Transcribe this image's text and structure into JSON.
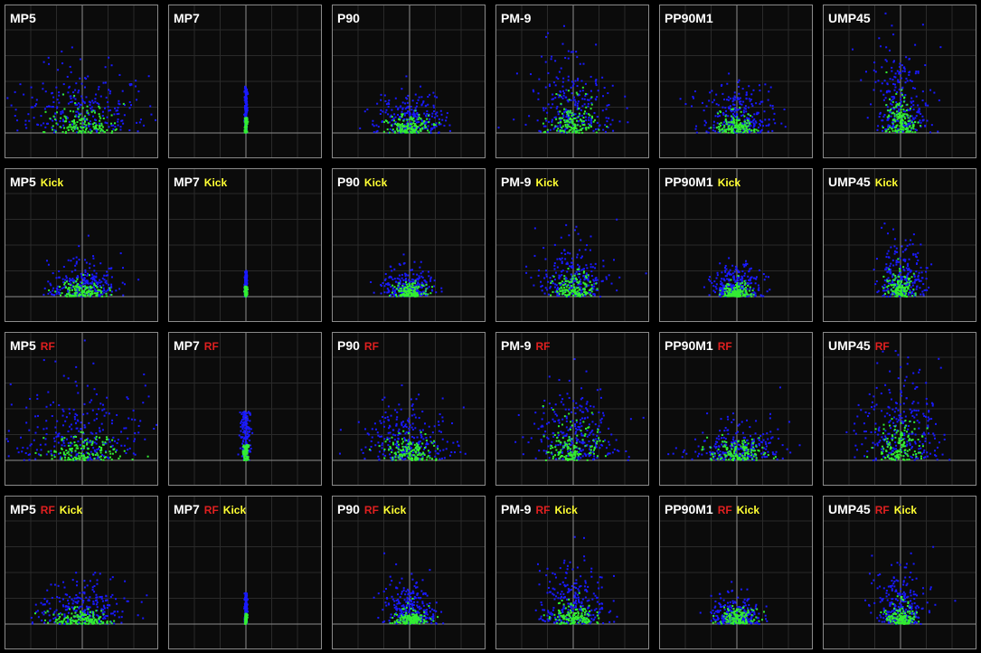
{
  "colors": {
    "background": "#000000",
    "panel_bg": "#0b0b0b",
    "panel_border": "#8a8a8a",
    "grid": "#2a2a2a",
    "axis": "#8c8c8c",
    "blue": "#1a1aff",
    "green": "#33ee33",
    "rf_tag": "#e02020",
    "kick_tag": "#ffff33"
  },
  "chart_data": {
    "type": "scatter",
    "grid": true,
    "weapons": [
      "MP5",
      "MP7",
      "P90",
      "PM-9",
      "PP90M1",
      "UMP45"
    ],
    "rows": [
      {
        "tags": []
      },
      {
        "tags": [
          "Kick"
        ]
      },
      {
        "tags": [
          "RF"
        ]
      },
      {
        "tags": [
          "RF",
          "Kick"
        ]
      }
    ],
    "series": [
      {
        "color": "blue"
      },
      {
        "color": "green"
      }
    ],
    "spread": [
      [
        {
          "bw": 2.3,
          "bh": 2.3,
          "gw": 1.3,
          "gh": 0.8
        },
        {
          "bw": 0.05,
          "bh": 1.8,
          "gw": 0.05,
          "gh": 0.6,
          "vertical": true
        },
        {
          "bw": 1.2,
          "bh": 1.4,
          "gw": 0.8,
          "gh": 0.6
        },
        {
          "bw": 1.4,
          "bh": 2.4,
          "gw": 0.8,
          "gh": 1.1
        },
        {
          "bw": 1.2,
          "bh": 1.6,
          "gw": 0.7,
          "gh": 0.7
        },
        {
          "bw": 1.0,
          "bh": 2.8,
          "gw": 0.5,
          "gh": 1.2
        }
      ],
      [
        {
          "bw": 1.2,
          "bh": 1.2,
          "gw": 0.8,
          "gh": 0.5
        },
        {
          "bw": 0.05,
          "bh": 1.0,
          "gw": 0.05,
          "gh": 0.4,
          "vertical": true
        },
        {
          "bw": 1.0,
          "bh": 0.9,
          "gw": 0.5,
          "gh": 0.4
        },
        {
          "bw": 1.2,
          "bh": 1.8,
          "gw": 0.7,
          "gh": 0.8
        },
        {
          "bw": 0.9,
          "bh": 1.0,
          "gw": 0.5,
          "gh": 0.5
        },
        {
          "bw": 0.9,
          "bh": 1.7,
          "gw": 0.5,
          "gh": 0.8
        }
      ],
      [
        {
          "bw": 2.4,
          "bh": 2.5,
          "gw": 1.3,
          "gh": 0.8
        },
        {
          "bw": 0.2,
          "bh": 1.9,
          "gw": 0.12,
          "gh": 0.6,
          "vertical": true
        },
        {
          "bw": 1.6,
          "bh": 1.8,
          "gw": 0.9,
          "gh": 0.8
        },
        {
          "bw": 1.5,
          "bh": 2.5,
          "gw": 0.9,
          "gh": 1.2
        },
        {
          "bw": 1.6,
          "bh": 1.2,
          "gw": 1.0,
          "gh": 0.7
        },
        {
          "bw": 1.4,
          "bh": 3.0,
          "gw": 0.8,
          "gh": 1.3
        }
      ],
      [
        {
          "bw": 1.5,
          "bh": 1.5,
          "gw": 1.0,
          "gh": 0.5
        },
        {
          "bw": 0.05,
          "bh": 1.2,
          "gw": 0.05,
          "gh": 0.4,
          "vertical": true
        },
        {
          "bw": 0.9,
          "bh": 1.4,
          "gw": 0.6,
          "gh": 0.5
        },
        {
          "bw": 1.2,
          "bh": 2.0,
          "gw": 0.7,
          "gh": 0.7
        },
        {
          "bw": 0.9,
          "bh": 0.9,
          "gw": 0.6,
          "gh": 0.5
        },
        {
          "bw": 0.9,
          "bh": 1.8,
          "gw": 0.5,
          "gh": 0.7
        }
      ]
    ]
  }
}
